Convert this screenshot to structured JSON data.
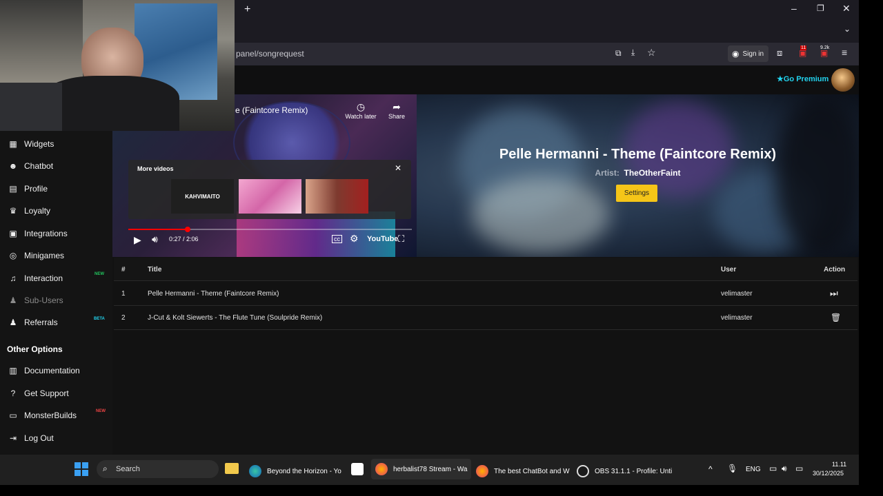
{
  "browser": {
    "url": "panel/songrequest",
    "sign_in": "Sign in",
    "notif_badge": "11",
    "ext_badge": "9.2k"
  },
  "header": {
    "premium": "Go Premium"
  },
  "sidebar": {
    "items": [
      {
        "label": "Widgets",
        "icon": "grid-icon"
      },
      {
        "label": "Chatbot",
        "icon": "robot-icon"
      },
      {
        "label": "Profile",
        "icon": "id-card-icon"
      },
      {
        "label": "Loyalty",
        "icon": "trophy-icon"
      },
      {
        "label": "Integrations",
        "icon": "integration-icon"
      },
      {
        "label": "Minigames",
        "icon": "gamepad-icon"
      },
      {
        "label": "Interaction",
        "icon": "music-icon",
        "badge": "NEW"
      },
      {
        "label": "Sub-Users",
        "icon": "users-icon"
      },
      {
        "label": "Referrals",
        "icon": "user-group-icon",
        "badge": "BETA"
      }
    ],
    "other_options_title": "Other Options",
    "other_items": [
      {
        "label": "Documentation",
        "icon": "doc-icon"
      },
      {
        "label": "Get Support",
        "icon": "help-icon"
      },
      {
        "label": "MonsterBuilds",
        "icon": "laptop-icon",
        "badge": "NEW"
      },
      {
        "label": "Log Out",
        "icon": "logout-icon"
      }
    ]
  },
  "player": {
    "video_title": "e (Faintcore Remix)",
    "watch_later": "Watch later",
    "share": "Share",
    "more_videos": "More videos",
    "thumb1_text": "KAHVIMAITO",
    "time": "0:27 / 2:06",
    "progress_fraction": 0.21,
    "youtube": "YouTube"
  },
  "now_playing": {
    "title": "Pelle Hermanni - Theme (Faintcore Remix)",
    "artist_label": "Artist:",
    "artist": "TheOtherFaint",
    "settings": "Settings"
  },
  "queue": {
    "headers": {
      "num": "#",
      "title": "Title",
      "user": "User",
      "action": "Action"
    },
    "rows": [
      {
        "num": "1",
        "title": "Pelle Hermanni - Theme (Faintcore Remix)",
        "user": "velimaster",
        "action": "skip-icon"
      },
      {
        "num": "2",
        "title": "J-Cut & Kolt Siewerts - The Flute Tune (Soulpride Remix)",
        "user": "velimaster",
        "action": "trash-icon"
      }
    ]
  },
  "taskbar": {
    "search": "Search",
    "apps": [
      {
        "label": "Beyond the Horizon - Yo"
      },
      {
        "label": "herbalist78 Stream - Wa"
      },
      {
        "label": "The best ChatBot and W"
      },
      {
        "label": "OBS 31.1.1 - Profile: Unti"
      }
    ],
    "lang": "ENG",
    "time": "11.11",
    "date": "30/12/2025"
  },
  "colors": {
    "accent": "#22d3ee",
    "settings_button": "#f5c518",
    "badge_new": "#22c55e",
    "badge_beta": "#22d3ee"
  }
}
